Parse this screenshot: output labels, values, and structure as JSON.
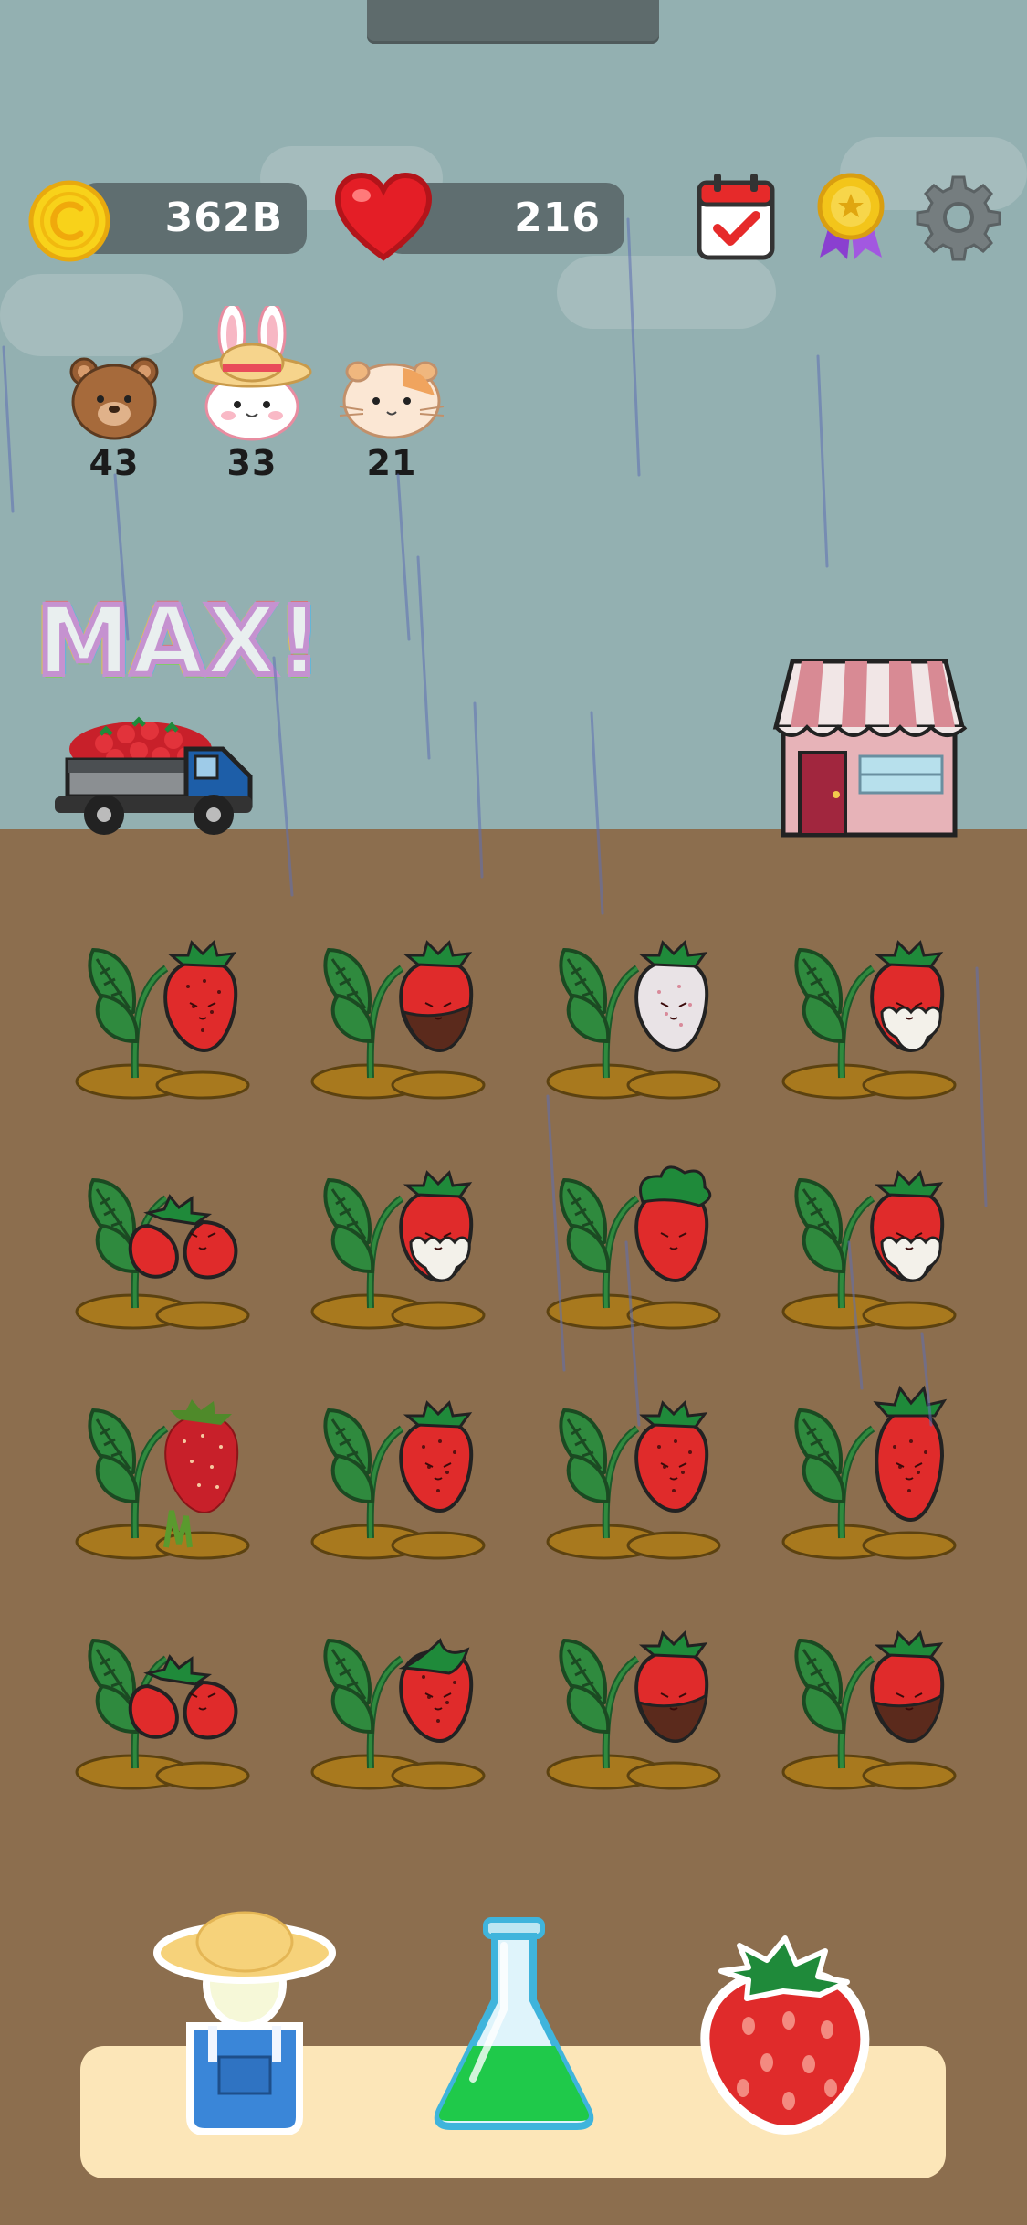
{
  "hud": {
    "coins": "362B",
    "hearts": "216",
    "icons": [
      "coin-icon",
      "heart-icon",
      "calendar-check-icon",
      "medal-icon",
      "gear-icon"
    ]
  },
  "animals": [
    {
      "name": "bear",
      "count": "43"
    },
    {
      "name": "bunny",
      "count": "33"
    },
    {
      "name": "hamster",
      "count": "21"
    }
  ],
  "truck": {
    "badge": "MAX!"
  },
  "plots": [
    {
      "berry": "normal"
    },
    {
      "berry": "chocolate"
    },
    {
      "berry": "white"
    },
    {
      "berry": "cream"
    },
    {
      "berry": "double"
    },
    {
      "berry": "cream"
    },
    {
      "berry": "big-leaf"
    },
    {
      "berry": "cream"
    },
    {
      "berry": "realistic"
    },
    {
      "berry": "normal"
    },
    {
      "berry": "normal"
    },
    {
      "berry": "tall"
    },
    {
      "berry": "double"
    },
    {
      "berry": "leafy"
    },
    {
      "berry": "chocolate"
    },
    {
      "berry": "chocolate"
    }
  ],
  "toolbar": {
    "buttons": [
      "farmer-icon",
      "flask-icon",
      "strawberry-icon"
    ]
  },
  "colors": {
    "sky": "#93b0b1",
    "ground": "#8c6e4e",
    "berry": "#e02b2b",
    "leaf": "#1f8a3a",
    "tray": "#fce6b8"
  }
}
